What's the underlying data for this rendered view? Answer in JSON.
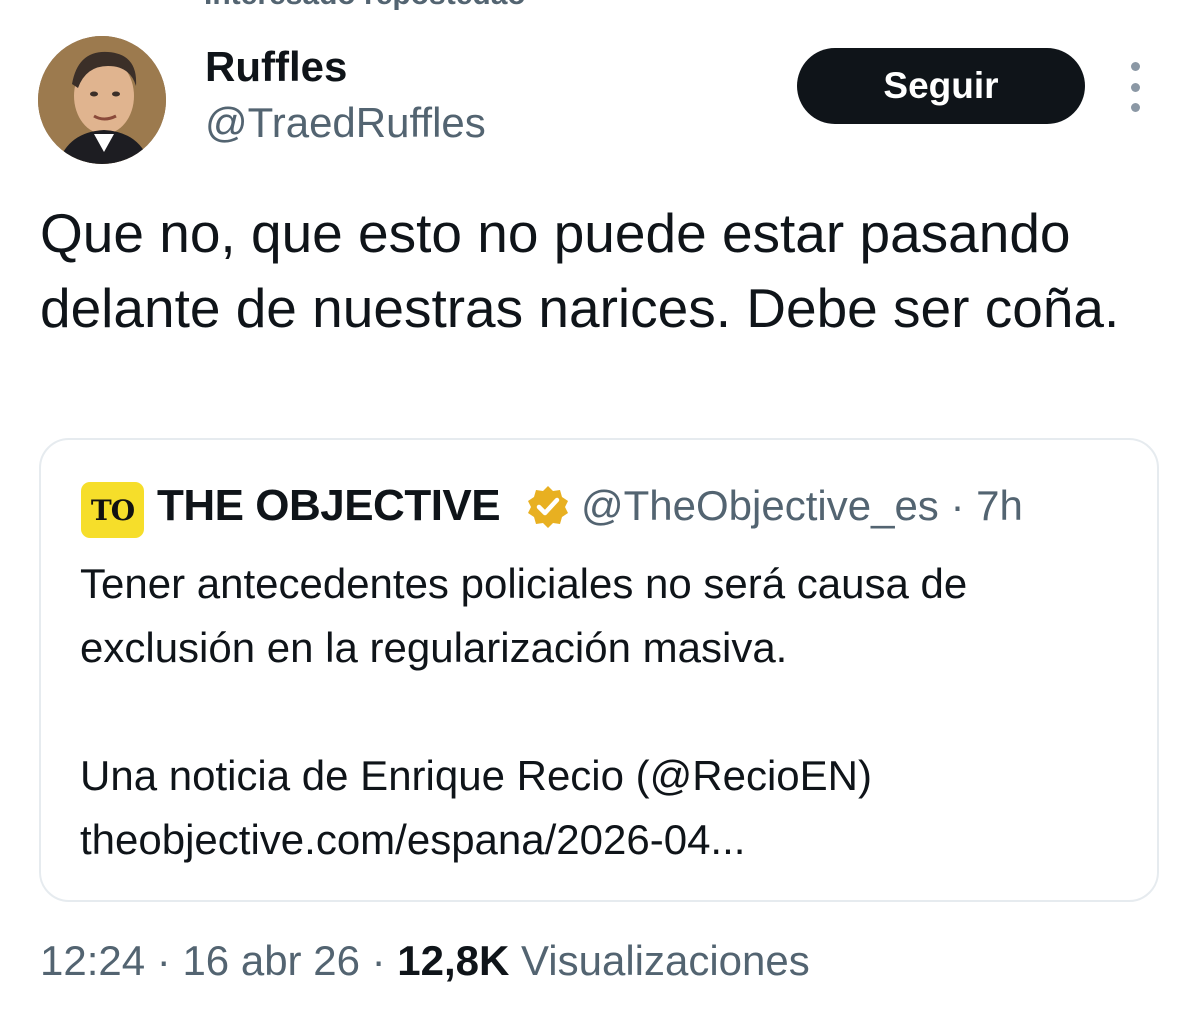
{
  "header_fragment": "Interesado repostedao",
  "author": {
    "name": "Ruffles",
    "handle": "@TraedRuffles"
  },
  "follow_label": "Seguir",
  "more_icon": "more-vertical-icon",
  "tweet_text": "Que no, que esto no puede estar pasando delante de nuestras narices. Debe ser coña.",
  "quote": {
    "logo_text": "TO",
    "logo_color": "#f6de2a",
    "name": "THE OBJECTIVE",
    "verified_color": "#e8b021",
    "handle": "@TheObjective_es",
    "separator": "·",
    "time": "7h",
    "paragraph1": "Tener antecedentes policiales no será causa de exclusión en la regularización masiva.",
    "paragraph2_line1": "Una noticia de Enrique Recio (@RecioEN)",
    "paragraph2_line2": "theobjective.com/espana/2026-04..."
  },
  "meta": {
    "time": "12:24",
    "separator": "·",
    "date": "16 abr 26",
    "views_count": "12,8K",
    "views_label": "Visualizaciones"
  },
  "colors": {
    "text_primary": "#0f1419",
    "text_secondary": "#536471",
    "button_bg": "#0f1419",
    "border": "#e6ebef"
  }
}
